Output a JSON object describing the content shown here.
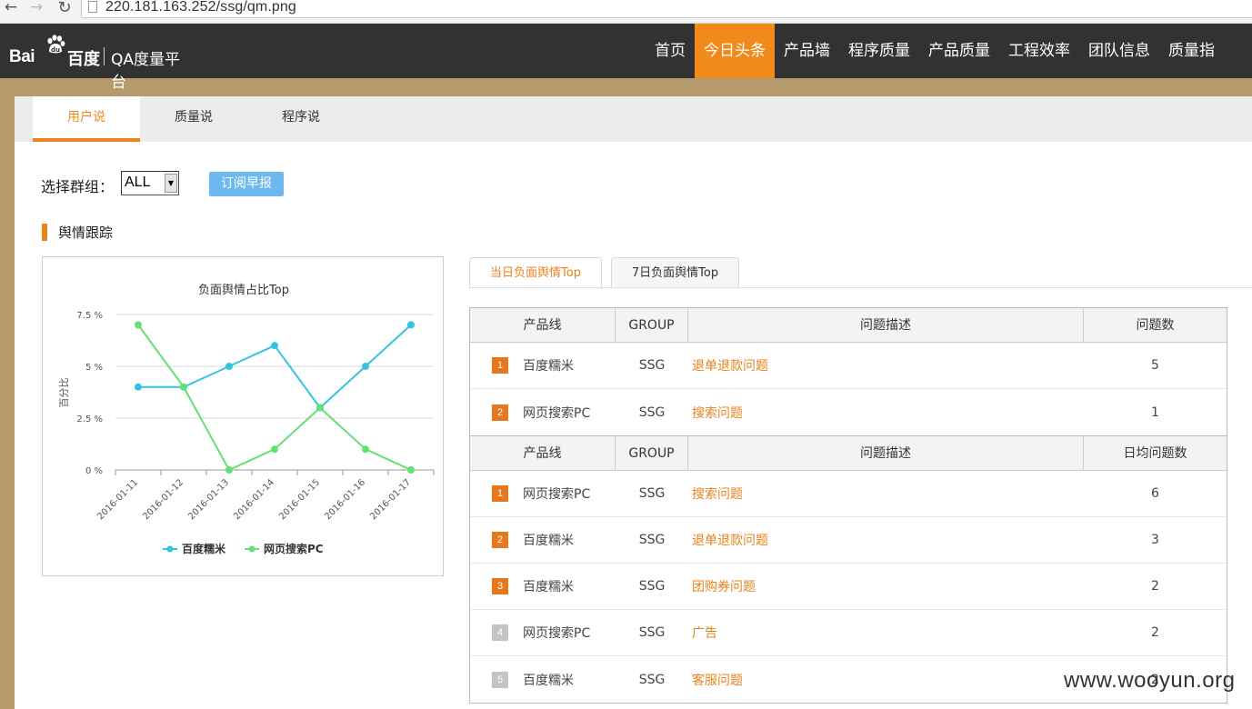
{
  "browser": {
    "url": "220.181.163.252/ssg/qm.png"
  },
  "header": {
    "logo_latin": "Bai",
    "logo_cn": "百度",
    "logo_sub": "QA度量平台",
    "nav": [
      "首页",
      "今日头条",
      "产品墙",
      "程序质量",
      "产品质量",
      "工程效率",
      "团队信息",
      "质量指"
    ]
  },
  "subtabs": [
    "用户说",
    "质量说",
    "程序说"
  ],
  "filter": {
    "label": "选择群组：",
    "value": "ALL",
    "button": "订阅早报"
  },
  "section": {
    "title": "舆情跟踪"
  },
  "colors": {
    "accent": "#e8831d",
    "series1": "#35c4e0",
    "series2": "#63df74"
  },
  "chart_data": {
    "type": "line",
    "title": "负面舆情占比Top",
    "ylabel": "百分比",
    "categories": [
      "2016-01-11",
      "2016-01-12",
      "2016-01-13",
      "2016-01-14",
      "2016-01-15",
      "2016-01-16",
      "2016-01-17"
    ],
    "yticks": [
      "0 %",
      "2.5 %",
      "5 %",
      "7.5 %"
    ],
    "ylim": [
      0,
      7.5
    ],
    "legend_position": "bottom",
    "series": [
      {
        "name": "百度糯米",
        "values": [
          4,
          4,
          5,
          6,
          3,
          5,
          7
        ]
      },
      {
        "name": "网页搜索PC",
        "values": [
          7,
          4,
          0,
          1,
          3,
          1,
          0
        ]
      }
    ]
  },
  "table_tabs": [
    "当日负面舆情Top",
    "7日负面舆情Top"
  ],
  "table1": {
    "headers": [
      "产品线",
      "GROUP",
      "问题描述",
      "问题数"
    ],
    "rows": [
      {
        "rank": "1",
        "product": "百度糯米",
        "group": "SSG",
        "desc": "退单退款问题",
        "count": "5"
      },
      {
        "rank": "2",
        "product": "网页搜索PC",
        "group": "SSG",
        "desc": "搜索问题",
        "count": "1"
      }
    ]
  },
  "table2": {
    "headers": [
      "产品线",
      "GROUP",
      "问题描述",
      "日均问题数"
    ],
    "rows": [
      {
        "rank": "1",
        "product": "网页搜索PC",
        "group": "SSG",
        "desc": "搜索问题",
        "count": "6"
      },
      {
        "rank": "2",
        "product": "百度糯米",
        "group": "SSG",
        "desc": "退单退款问题",
        "count": "3"
      },
      {
        "rank": "3",
        "product": "百度糯米",
        "group": "SSG",
        "desc": "团购券问题",
        "count": "2"
      },
      {
        "rank": "4",
        "product": "网页搜索PC",
        "group": "SSG",
        "desc": "广告",
        "count": "2"
      },
      {
        "rank": "5",
        "product": "百度糯米",
        "group": "SSG",
        "desc": "客服问题",
        "count": "2"
      }
    ]
  },
  "watermark": "www.wooyun.org"
}
